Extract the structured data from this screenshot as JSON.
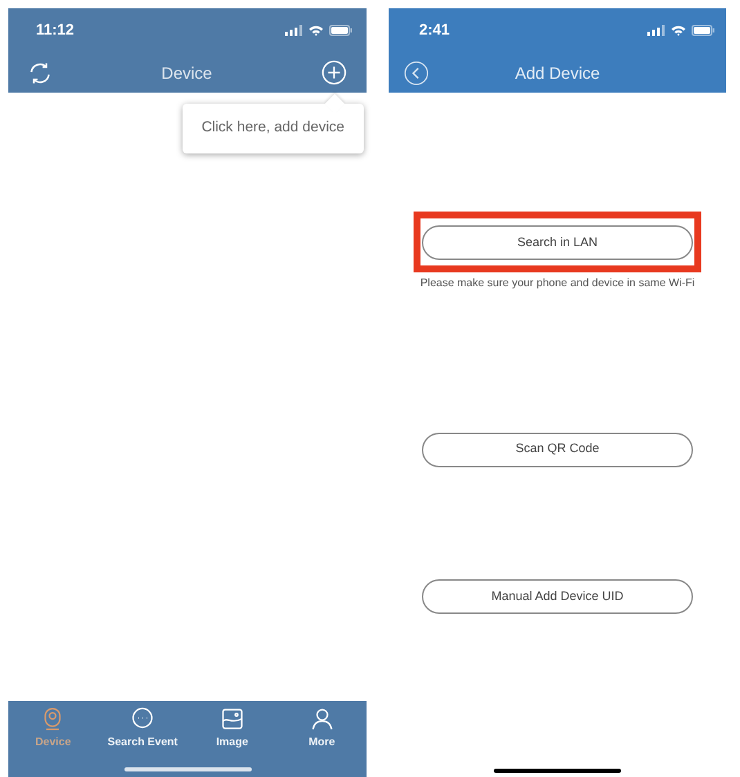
{
  "device_screen": {
    "status_bar": {
      "time": "11:12"
    },
    "title": "Device",
    "tooltip": "Click here, add device",
    "tab_bar": [
      {
        "label": "Device",
        "kind": "camera",
        "selected": true
      },
      {
        "label": "Search Event",
        "kind": "chat",
        "selected": false
      },
      {
        "label": "Image",
        "kind": "image",
        "selected": false
      },
      {
        "label": "More",
        "kind": "person",
        "selected": false
      }
    ]
  },
  "add_device_screen": {
    "status_bar": {
      "time": "2:41"
    },
    "title": "Add Device",
    "options": [
      {
        "label": "Search in LAN",
        "highlighted": true,
        "note": "Please make sure your phone and device in same Wi-Fi"
      },
      {
        "label": "Scan QR Code",
        "highlighted": false
      },
      {
        "label": "Manual Add Device UID",
        "highlighted": false
      }
    ]
  }
}
